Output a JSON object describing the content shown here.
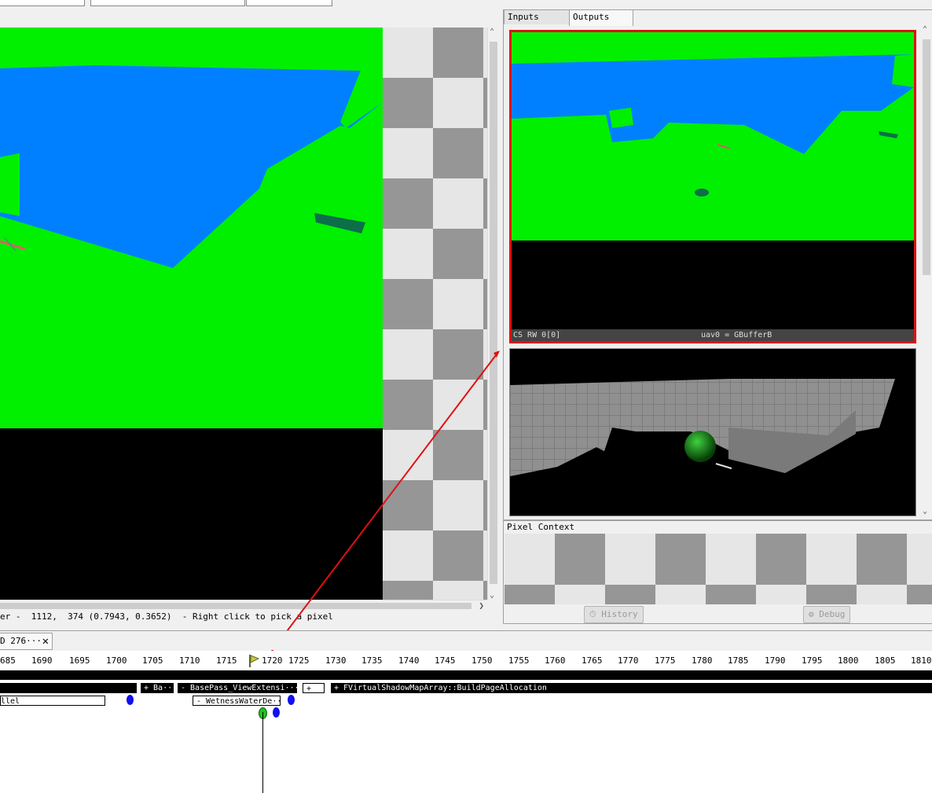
{
  "viewer": {
    "status": "er -  1112,  374 (0.7943, 0.3652)  - Right click to pick a pixel"
  },
  "right_pane": {
    "tabs": [
      {
        "label": "Inputs",
        "active": false
      },
      {
        "label": "Outputs",
        "active": true
      }
    ],
    "thumbnail1": {
      "label_left": "CS RW 0[0]",
      "label_center": "uav0 = GBufferB"
    }
  },
  "pixel_context": {
    "title": "Pixel Context",
    "history_label": "History",
    "debug_label": "Debug"
  },
  "timeline": {
    "tab_label": "D 276···",
    "ticks": [
      "685",
      "1690",
      "1695",
      "1700",
      "1705",
      "1710",
      "1715",
      "1720",
      "1725",
      "1730",
      "1735",
      "1740",
      "1745",
      "1750",
      "1755",
      "1760",
      "1765",
      "1770",
      "1775",
      "1780",
      "1785",
      "1790",
      "1795",
      "1800",
      "1805",
      "1810"
    ],
    "markers": {
      "parallel": "llel",
      "ba": "+ Ba···",
      "basepass": "- BasePass_ViewExtensi···",
      "plus": "+",
      "vsm": "+ FVirtualShadowMapArray::BuildPageAllocation",
      "wetness": "- WetnessWaterDe···"
    }
  },
  "colors": {
    "gbuffer_blue": "#0080ff",
    "gbuffer_green": "#00f000",
    "highlight_red": "#e01010",
    "event_blue": "#1010f0",
    "event_green": "#20c020"
  }
}
